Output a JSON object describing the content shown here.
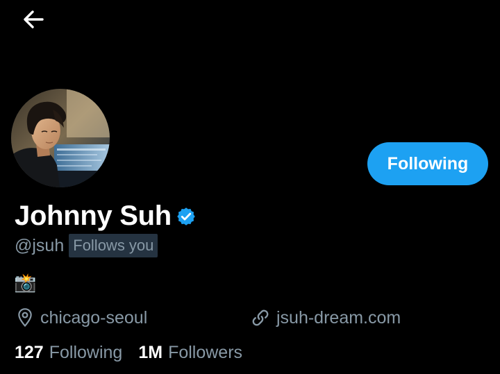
{
  "colors": {
    "background": "#000000",
    "accent": "#1da1f2",
    "secondary_text": "#8899a6",
    "badge_background": "#253341"
  },
  "header": {
    "back_icon": "arrow-left-icon"
  },
  "profile": {
    "avatar_icon": "profile-photo",
    "follow_button_label": "Following",
    "display_name": "Johnny Suh",
    "verified_icon": "verified-badge-icon",
    "handle": "@jsuh",
    "follows_you_label": "Follows you",
    "bio": "📸",
    "location_icon": "location-pin-icon",
    "location": "chicago-seoul",
    "link_icon": "link-icon",
    "website": "jsuh-dream.com"
  },
  "stats": {
    "following_count": "127",
    "following_label": "Following",
    "followers_count": "1M",
    "followers_label": "Followers"
  }
}
